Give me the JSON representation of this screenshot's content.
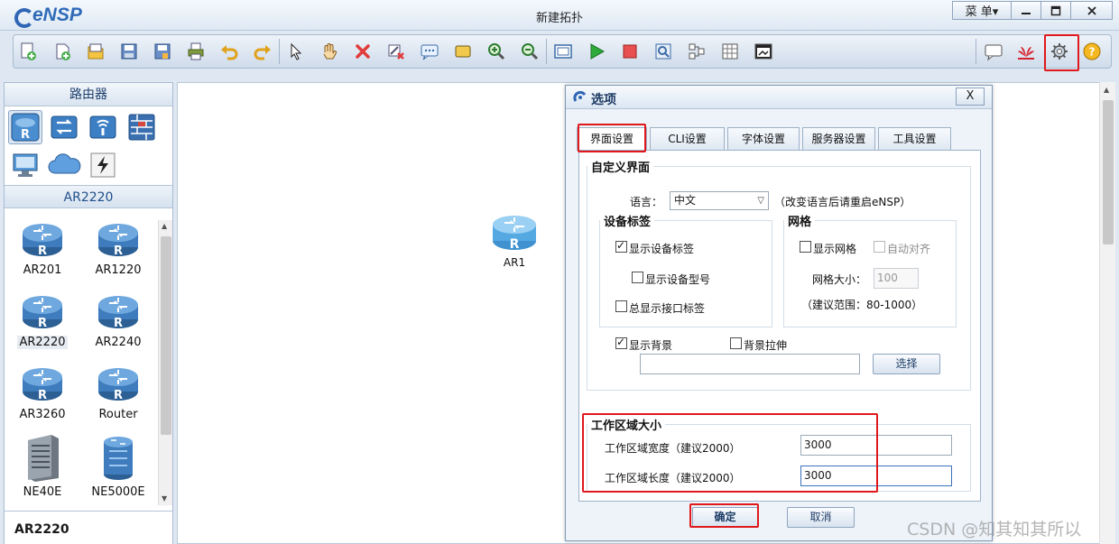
{
  "app": {
    "logo_text": "eNSP",
    "window_title": "新建拓扑"
  },
  "window_controls": {
    "menu_label": "菜 单▾",
    "minimize": "—",
    "maximize": "☐",
    "close": "✕"
  },
  "toolbar": {
    "tools": [
      "new-topology",
      "new-template",
      "open",
      "save",
      "save-as",
      "print",
      "undo",
      "redo",
      "select",
      "pan",
      "delete",
      "delete-link",
      "add-text",
      "palette",
      "zoom-in",
      "zoom-out",
      "fit-view",
      "start",
      "stop",
      "capture",
      "topology",
      "grid-view",
      "terminal"
    ],
    "right_tools": [
      "message",
      "huawei-logo",
      "settings",
      "help"
    ]
  },
  "left_panel": {
    "header": "路由器",
    "categories": [
      "router",
      "switch",
      "wireless",
      "firewall",
      "pc",
      "cloud",
      "link"
    ],
    "subheader": "AR2220",
    "devices": [
      {
        "label": "AR201"
      },
      {
        "label": "AR1220"
      },
      {
        "label": "AR2220"
      },
      {
        "label": "AR2240"
      },
      {
        "label": "AR3260"
      },
      {
        "label": "Router"
      },
      {
        "label": "NE40E"
      },
      {
        "label": "NE5000E"
      }
    ],
    "selected_device": "AR2220",
    "footer": "AR2220"
  },
  "canvas": {
    "node_label": "AR1"
  },
  "dialog": {
    "title": "选项",
    "close": "X",
    "tabs": [
      "界面设置",
      "CLI设置",
      "字体设置",
      "服务器设置",
      "工具设置"
    ],
    "active_tab": 0,
    "custom_ui": {
      "legend": "自定义界面",
      "language_label": "语言：",
      "language_value": "中文",
      "language_note": "（改变语言后请重启eNSP）"
    },
    "device_label": {
      "legend": "设备标签",
      "show_label": {
        "text": "显示设备标签",
        "checked": true
      },
      "show_model": {
        "text": "显示设备型号",
        "checked": false
      },
      "show_iface": {
        "text": "总显示接口标签",
        "checked": false
      }
    },
    "grid": {
      "legend": "网格",
      "show_grid": {
        "text": "显示网格",
        "checked": false
      },
      "auto_align": {
        "text": "自动对齐",
        "checked": false
      },
      "size_label": "网格大小：",
      "size_value": "100",
      "range_note": "（建议范围：80-1000）"
    },
    "background": {
      "show_bg": {
        "text": "显示背景",
        "checked": true
      },
      "stretch": {
        "text": "背景拉伸",
        "checked": false
      },
      "path_value": "",
      "choose_btn": "选择"
    },
    "workspace": {
      "legend": "工作区域大小",
      "width_label": "工作区域宽度（建议2000）",
      "width_value": "3000",
      "length_label": "工作区域长度（建议2000）",
      "length_value": "3000"
    },
    "ok": "确定",
    "cancel": "取消"
  },
  "watermark": "CSDN @知其知其所以",
  "colors": {
    "accent": "#2f6ab8",
    "highlight_box": "#e0181c",
    "router_blue": "#3b87c6"
  }
}
